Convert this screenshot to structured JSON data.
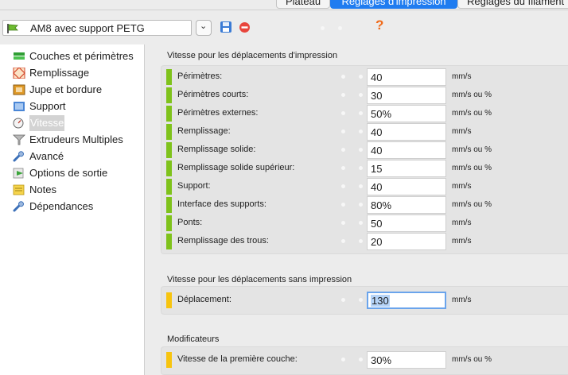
{
  "colors": {
    "accent": "#1f7cf0",
    "bar_expert": "#7fc21b",
    "bar_simple": "#f7c40f",
    "help": "#f06a1a"
  },
  "tabs": [
    {
      "label": "Plateau",
      "active": false
    },
    {
      "label": "Réglages d'impression",
      "active": true
    },
    {
      "label": "Réglages du filament",
      "active": false
    }
  ],
  "preset": {
    "name": "AM8 avec support PETG",
    "icon": "green-flag-icon",
    "dropdown_icon": "chevron-down-icon",
    "save_icon": "floppy-save-icon",
    "delete_icon": "red-delete-icon",
    "help_glyph": "?"
  },
  "sidebar": {
    "items": [
      {
        "label": "Couches et périmètres",
        "icon": "layers-icon"
      },
      {
        "label": "Remplissage",
        "icon": "infill-icon"
      },
      {
        "label": "Jupe et bordure",
        "icon": "skirt-icon"
      },
      {
        "label": "Support",
        "icon": "support-icon"
      },
      {
        "label": "Vitesse",
        "icon": "speedometer-icon",
        "selected": true
      },
      {
        "label": "Extrudeurs Multiples",
        "icon": "funnel-icon"
      },
      {
        "label": "Avancé",
        "icon": "wrench-icon"
      },
      {
        "label": "Options de sortie",
        "icon": "export-icon"
      },
      {
        "label": "Notes",
        "icon": "note-icon"
      },
      {
        "label": "Dépendances",
        "icon": "wrench-icon"
      }
    ]
  },
  "sections": [
    {
      "title": "Vitesse pour les déplacements d'impression",
      "rows": [
        {
          "label": "Périmètres:",
          "value": "40",
          "unit": "mm/s",
          "level": "expert"
        },
        {
          "label": "Périmètres courts:",
          "value": "30",
          "unit": "mm/s ou %",
          "level": "expert"
        },
        {
          "label": "Périmètres externes:",
          "value": "50%",
          "unit": "mm/s ou %",
          "level": "expert"
        },
        {
          "label": "Remplissage:",
          "value": "40",
          "unit": "mm/s",
          "level": "expert"
        },
        {
          "label": "Remplissage solide:",
          "value": "40",
          "unit": "mm/s ou %",
          "level": "expert"
        },
        {
          "label": "Remplissage solide supérieur:",
          "value": "15",
          "unit": "mm/s ou %",
          "level": "expert"
        },
        {
          "label": "Support:",
          "value": "40",
          "unit": "mm/s",
          "level": "expert"
        },
        {
          "label": "Interface des supports:",
          "value": "80%",
          "unit": "mm/s ou %",
          "level": "expert"
        },
        {
          "label": "Ponts:",
          "value": "50",
          "unit": "mm/s",
          "level": "expert"
        },
        {
          "label": "Remplissage des trous:",
          "value": "20",
          "unit": "mm/s",
          "level": "expert"
        }
      ]
    },
    {
      "title": "Vitesse pour les déplacements sans impression",
      "rows": [
        {
          "label": "Déplacement:",
          "value": "130",
          "unit": "mm/s",
          "level": "simple",
          "focused": true
        }
      ]
    },
    {
      "title": "Modificateurs",
      "rows": [
        {
          "label": "Vitesse de la première couche:",
          "value": "30%",
          "unit": "mm/s ou %",
          "level": "simple"
        }
      ]
    }
  ]
}
